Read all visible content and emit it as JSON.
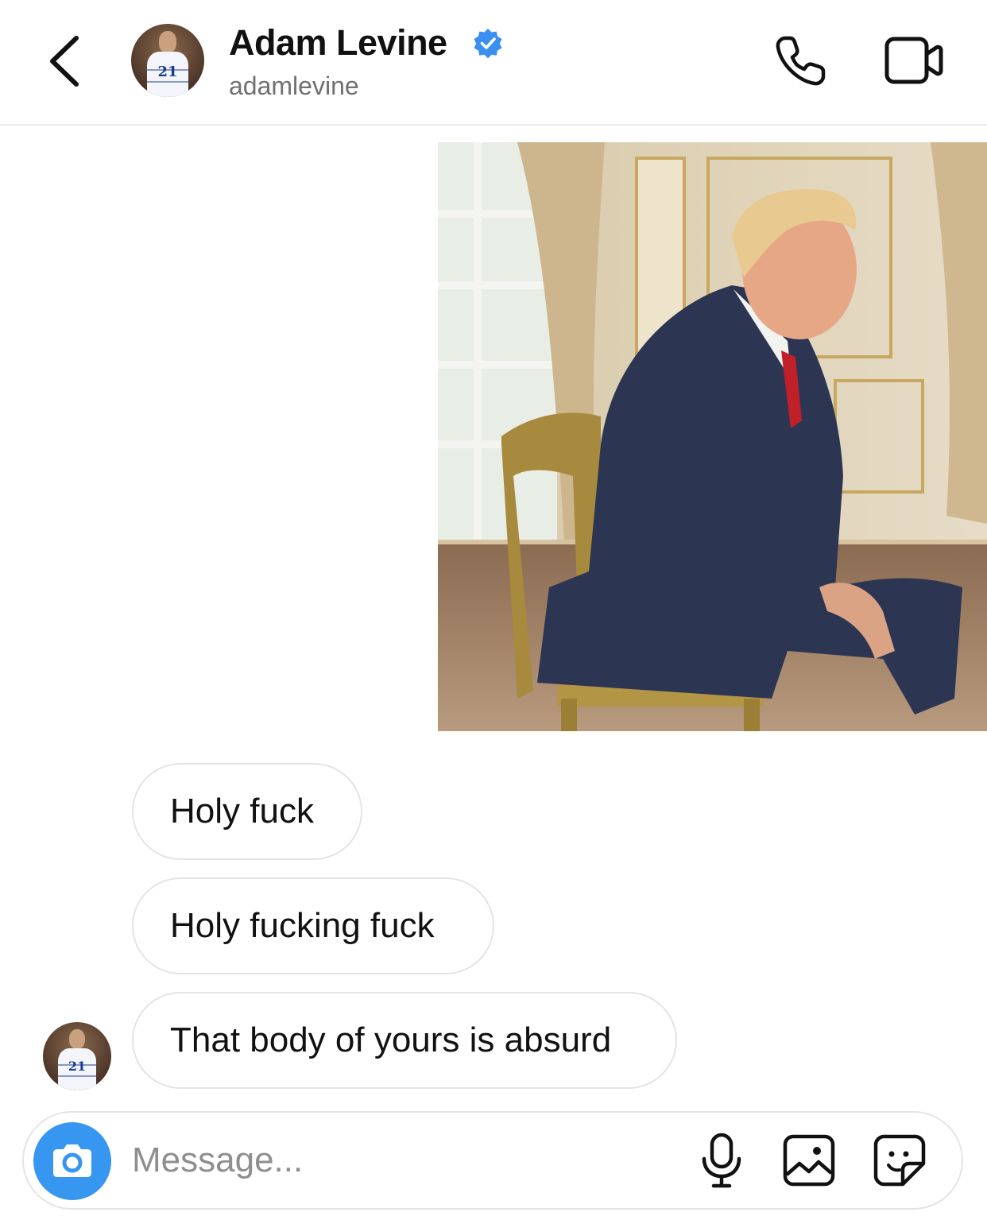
{
  "header": {
    "name": "Adam Levine",
    "handle": "adamlevine",
    "verified": true,
    "avatar_jersey_number": "21",
    "icons": {
      "back": "chevron-left-icon",
      "verified": "verified-badge-icon",
      "call": "phone-icon",
      "video": "video-camera-icon"
    }
  },
  "conversation": {
    "shared_image": "photo-man-in-suit-seated-on-chair",
    "messages": [
      {
        "text": "Holy fuck"
      },
      {
        "text": "Holy fucking fuck"
      },
      {
        "text": "That body of yours is absurd"
      }
    ]
  },
  "composer": {
    "placeholder": "Message...",
    "icons": {
      "camera": "camera-icon",
      "mic": "microphone-icon",
      "gallery": "image-icon",
      "sticker": "sticker-icon"
    }
  },
  "colors": {
    "accent_blue": "#3797f0",
    "verified_blue": "#3b8ff0",
    "bubble_border": "#e4e4e4",
    "secondary_text": "#707070",
    "placeholder_text": "#8e8e8e"
  }
}
